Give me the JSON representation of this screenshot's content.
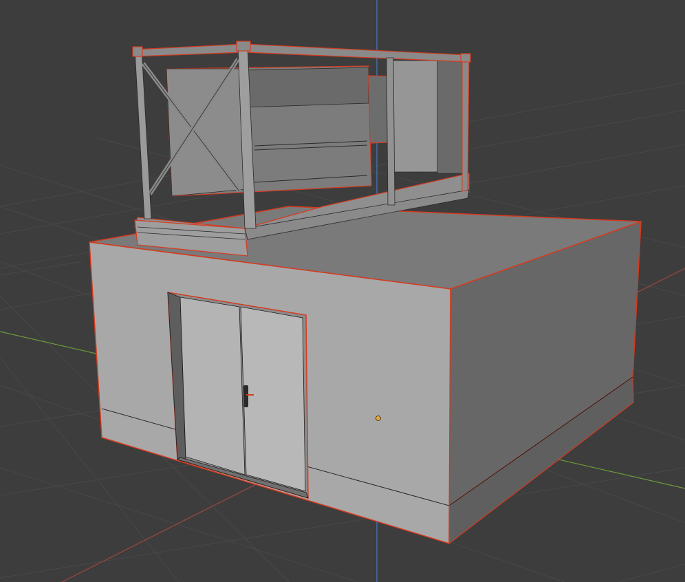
{
  "viewport": {
    "background": "#3d3d3d",
    "grid_color": "#4a4a4a",
    "axis_x_color": "#9b4747",
    "axis_y_color": "#6e9b3a",
    "axis_z_color": "#4a78c8",
    "selection_outline_color": "#d63a1e",
    "origin_color": "#e8a23a"
  },
  "scene": {
    "object_type": "mesh",
    "selected": true,
    "shading": "solid"
  }
}
